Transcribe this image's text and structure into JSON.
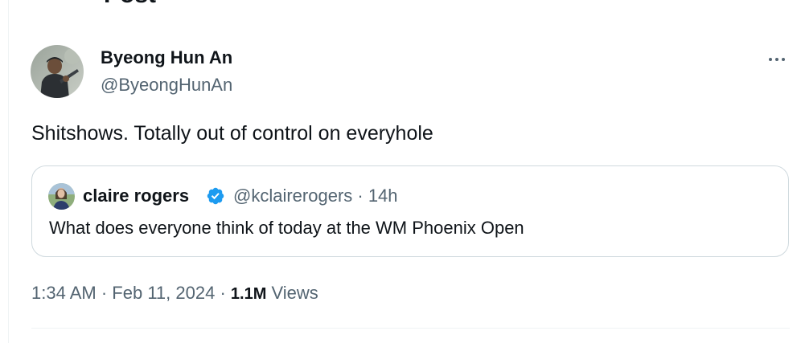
{
  "header": {
    "title": "Post"
  },
  "author": {
    "display_name": "Byeong Hun An",
    "handle": "@ByeongHunAn"
  },
  "tweet": {
    "text": "Shitshows. Totally out of control on everyhole"
  },
  "quoted_tweet": {
    "display_name": "claire rogers",
    "handle_and_time": "@kclairerogers · 14h",
    "text": "What does everyone think of today at the WM Phoenix Open",
    "verified": true
  },
  "meta": {
    "time": "1:34 AM",
    "separator": "·",
    "date": "Feb 11, 2024",
    "views_count": "1.1M",
    "views_label": "Views"
  },
  "colors": {
    "text_primary": "#0f1419",
    "text_secondary": "#536471",
    "verified_blue": "#1d9bf0",
    "border": "#cfd9de"
  },
  "icons": {
    "back": "arrow-left-icon",
    "more": "more-horizontal-icon",
    "verified": "verified-badge-icon"
  }
}
